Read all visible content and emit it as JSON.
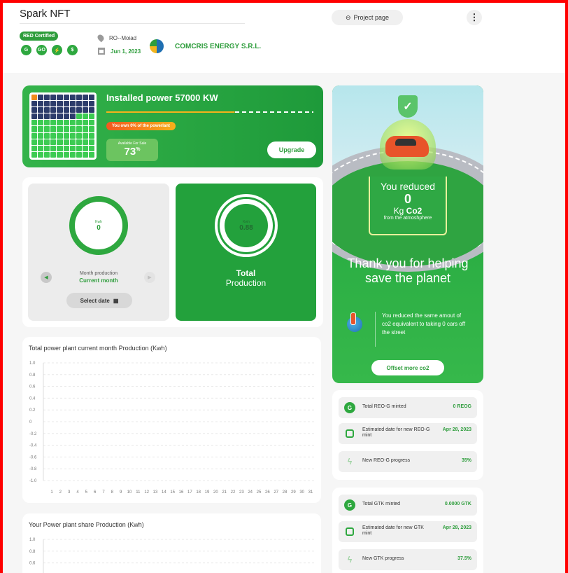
{
  "header": {
    "title": "Spark NFT",
    "red_badge": "RED Certified",
    "cert_icons": [
      "G",
      "GO",
      "⚡",
      "$"
    ],
    "location": "RO--Moiad",
    "date": "Jun 1, 2023",
    "company": "COMCRIS ENERGY S.R.L.",
    "project_btn": "Project page",
    "menu_icon": "⋮"
  },
  "power_card": {
    "title": "Installed power 57000 KW",
    "own_text": "You own 0% of the powerlant",
    "available_label": "Available For Sale",
    "available_value": "73",
    "available_unit": "%",
    "upgrade_btn": "Upgrade",
    "own_progress": 0.62
  },
  "production": {
    "month_unit": "Kwh",
    "month_value": "0",
    "month_label": "Month production",
    "month_current": "Current month",
    "select_date": "Select date",
    "total_unit": "Kwh",
    "total_value": "0.88",
    "total_label_1": "Total",
    "total_label_2": "Production"
  },
  "chart1": {
    "title": "Total power plant current month Production (Kwh)"
  },
  "chart2": {
    "title": "Your Power plant share Production (Kwh)"
  },
  "chart_data": [
    {
      "type": "line",
      "title": "Total power plant current month Production (Kwh)",
      "xlabel": "",
      "ylabel": "",
      "x": [
        1,
        2,
        3,
        4,
        5,
        6,
        7,
        8,
        9,
        10,
        11,
        12,
        13,
        14,
        15,
        16,
        17,
        18,
        19,
        20,
        21,
        22,
        23,
        24,
        25,
        26,
        27,
        28,
        29,
        30,
        31
      ],
      "series": [],
      "ylim": [
        -1.0,
        1.0
      ],
      "yticks": [
        "1.0",
        "0.8",
        "0.6",
        "0.4",
        "0.2",
        "0",
        "-0.2",
        "-0.4",
        "-0.6",
        "-0.8",
        "-1.0"
      ],
      "grid": true
    },
    {
      "type": "line",
      "title": "Your Power plant share Production (Kwh)",
      "xlabel": "",
      "ylabel": "",
      "series": [],
      "yticks": [
        "1.0",
        "0.8",
        "0.6"
      ],
      "grid": true
    }
  ],
  "co2": {
    "reduced_top": "You reduced",
    "reduced_value": "0",
    "reduced_unit_prefix": "Kg ",
    "reduced_unit": "Co2",
    "reduced_sub": "from the atmoshphere",
    "thank_you": "Thank you for helping save the planet",
    "reduce_text": "You reduced the same amout of co2 equivalent to taking 0 cars off the street",
    "offset_btn": "Offset more co2"
  },
  "reog": {
    "total_label": "Total REO-G minted",
    "total_value": "0 REOG",
    "est_label": "Estimated date for new REO-G mint",
    "est_value": "Apr 28, 2023",
    "progress_label": "New REO-G progress",
    "progress_value": "35%"
  },
  "gtk": {
    "total_label": "Total GTK minted",
    "total_value": "0.0000 GTK",
    "est_label": "Estimated date for new GTK mint",
    "est_value": "Apr 28, 2023",
    "progress_label": "New GTK progress",
    "progress_value": "37.5%"
  },
  "colors": {
    "accent": "#2e9d3c",
    "dark_green": "#23a13c",
    "frame": "#ff0000"
  }
}
